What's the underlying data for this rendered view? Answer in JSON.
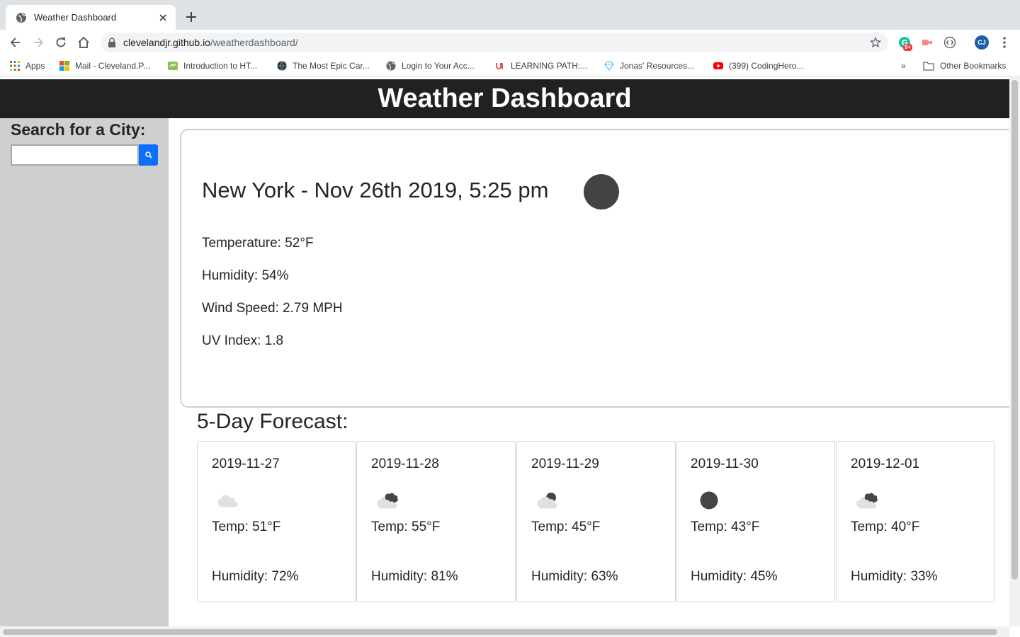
{
  "browser": {
    "tab": {
      "title": "Weather Dashboard"
    },
    "url": {
      "domain": "clevelandjr.github.io",
      "path": "/weatherdashboard/"
    },
    "extension_badge": "9+",
    "profile_initials": "CJ",
    "bookmarks": [
      {
        "label": "Apps",
        "icon": "apps-grid-icon"
      },
      {
        "label": "Mail - Cleveland.P...",
        "icon": "microsoft-icon"
      },
      {
        "label": "Introduction to HT...",
        "icon": "course-icon"
      },
      {
        "label": "The Most Epic Car...",
        "icon": "globe-dark-icon"
      },
      {
        "label": "Login to Your Acc...",
        "icon": "globe-icon"
      },
      {
        "label": "LEARNING PATH:...",
        "icon": "udemy-icon"
      },
      {
        "label": "Jonas' Resources...",
        "icon": "diamond-icon"
      },
      {
        "label": "(399) CodingHero...",
        "icon": "youtube-icon"
      }
    ],
    "other_bookmarks": "Other Bookmarks",
    "overflow": "»"
  },
  "header": {
    "title": "Weather Dashboard"
  },
  "sidebar": {
    "heading": "Search for a City:",
    "search_value": "",
    "search_button_icon": "search-icon"
  },
  "current": {
    "title": "New York - Nov 26th 2019, 5:25 pm",
    "icon": "clear-night-icon",
    "temperature": "Temperature: 52°F",
    "humidity": "Humidity: 54%",
    "wind": "Wind Speed: 2.79 MPH",
    "uv": "UV Index: 1.8"
  },
  "forecast": {
    "title": "5-Day Forecast:",
    "days": [
      {
        "date": "2019-11-27",
        "icon": "cloud-icon",
        "temp": "Temp: 51°F",
        "humidity": "Humidity: 72%"
      },
      {
        "date": "2019-11-28",
        "icon": "broken-clouds-night-icon",
        "temp": "Temp: 55°F",
        "humidity": "Humidity: 81%"
      },
      {
        "date": "2019-11-29",
        "icon": "partly-cloudy-night-icon",
        "temp": "Temp: 45°F",
        "humidity": "Humidity: 63%"
      },
      {
        "date": "2019-11-30",
        "icon": "clear-night-icon",
        "temp": "Temp: 43°F",
        "humidity": "Humidity: 45%"
      },
      {
        "date": "2019-12-01",
        "icon": "broken-clouds-night-icon",
        "temp": "Temp: 40°F",
        "humidity": "Humidity: 33%"
      }
    ]
  },
  "colors": {
    "header_bg": "#212121",
    "sidebar_bg": "#cfcfcf",
    "search_button": "#0d6efd",
    "icon_dark": "#434343"
  }
}
